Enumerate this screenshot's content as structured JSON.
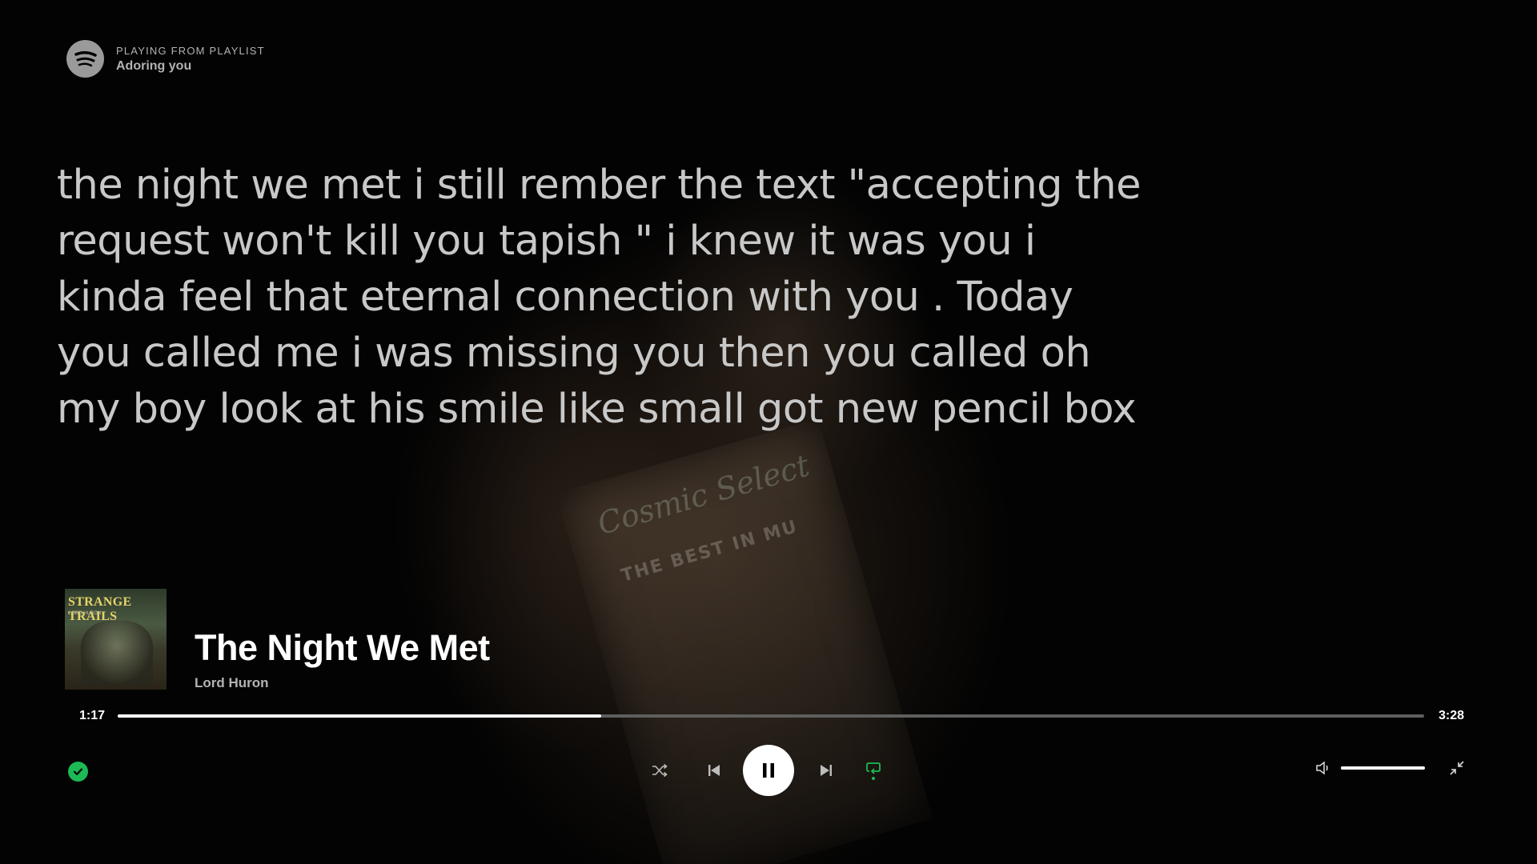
{
  "header": {
    "kicker": "PLAYING FROM PLAYLIST",
    "playlist_name": "Adoring you"
  },
  "lyrics": {
    "text": "the night we met i still rember the text \"accepting the request won't kill you tapish \" i knew it was you i kinda feel that eternal connection with you . Today you called me i was missing you then you called oh my boy look at his smile like small got new pencil box"
  },
  "background": {
    "jukebox_sign": "Cosmic Select",
    "jukebox_sub": "THE BEST IN MU"
  },
  "album": {
    "title_text": "STRANGE TRAILS",
    "artist_text": "LORD HURON"
  },
  "track": {
    "title": "The Night We Met",
    "artist": "Lord Huron"
  },
  "playback": {
    "elapsed": "1:17",
    "total": "3:28",
    "progress_fraction": 0.37,
    "volume_fraction": 1.0,
    "state": "playing",
    "repeat_on": true,
    "liked": true
  },
  "icons": {
    "logo": "spotify-icon",
    "shuffle": "shuffle-icon",
    "previous": "skip-back-icon",
    "play_pause": "pause-icon",
    "next": "skip-forward-icon",
    "repeat": "repeat-icon",
    "liked": "check-circle-icon",
    "volume": "volume-icon",
    "exit_fullscreen": "minimize-icon"
  },
  "colors": {
    "accent": "#1db954",
    "text_primary": "#ffffff",
    "text_secondary": "#b3b3b3",
    "lyrics": "#c8c8c8",
    "track_bg": "#5e5e5e"
  }
}
